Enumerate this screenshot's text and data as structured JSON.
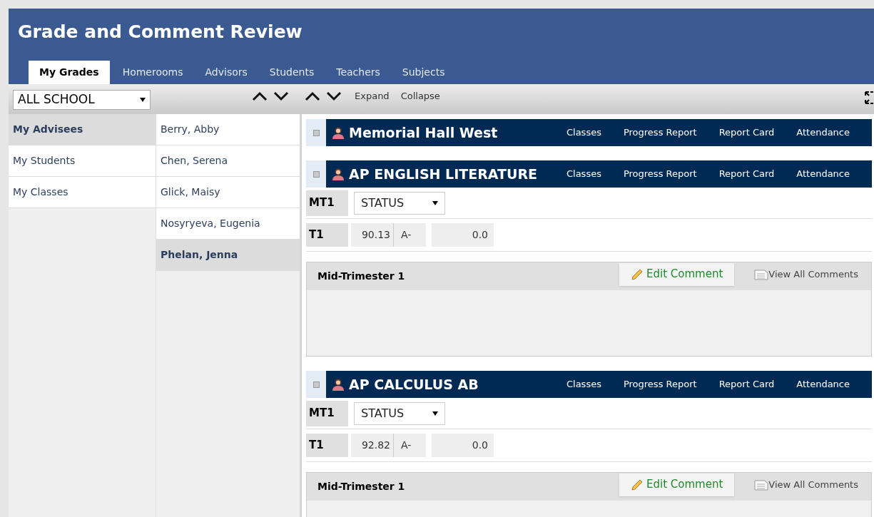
{
  "title": "Grade and Comment Review",
  "tabs": [
    {
      "label": "My Grades",
      "selected": true
    },
    {
      "label": "Homerooms",
      "selected": false
    },
    {
      "label": "Advisors",
      "selected": false
    },
    {
      "label": "Students",
      "selected": false
    },
    {
      "label": "Teachers",
      "selected": false
    },
    {
      "label": "Subjects",
      "selected": false
    }
  ],
  "toolbar": {
    "scope_select": "ALL SCHOOL",
    "expand": "Expand",
    "collapse": "Collapse"
  },
  "sidebar": [
    {
      "label": "My Advisees",
      "selected": true
    },
    {
      "label": "My Students",
      "selected": false
    },
    {
      "label": "My Classes",
      "selected": false
    }
  ],
  "students": [
    {
      "label": "Berry, Abby",
      "selected": false
    },
    {
      "label": "Chen, Serena",
      "selected": false
    },
    {
      "label": "Glick, Maisy",
      "selected": false
    },
    {
      "label": "Nosyryeva, Eugenia",
      "selected": false
    },
    {
      "label": "Phelan, Jenna",
      "selected": true
    }
  ],
  "sections": [
    {
      "title": "Memorial Hall West",
      "links": [
        "Classes",
        "Progress Report",
        "Report Card",
        "Attendance"
      ]
    },
    {
      "title": "AP ENGLISH LITERATURE",
      "links": [
        "Classes",
        "Progress Report",
        "Report Card",
        "Attendance"
      ],
      "status_row": {
        "label": "MT1",
        "select": "STATUS"
      },
      "grade_row": {
        "label": "T1",
        "score": "90.13",
        "letter": "A-",
        "value": "0.0"
      },
      "comment": {
        "title": "Mid-Trimester 1",
        "edit": "Edit Comment",
        "view": "View All Comments"
      }
    },
    {
      "title": "AP CALCULUS AB",
      "links": [
        "Classes",
        "Progress Report",
        "Report Card",
        "Attendance"
      ],
      "status_row": {
        "label": "MT1",
        "select": "STATUS"
      },
      "grade_row": {
        "label": "T1",
        "score": "92.82",
        "letter": "A-",
        "value": "0.0"
      },
      "comment": {
        "title": "Mid-Trimester 1",
        "edit": "Edit Comment",
        "view": "View All Comments"
      }
    }
  ]
}
